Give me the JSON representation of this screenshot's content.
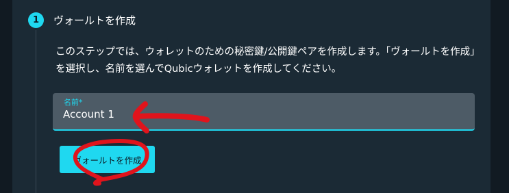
{
  "step": {
    "number": "1",
    "title": "ヴォールトを作成"
  },
  "description": "このステップでは、ウォレットのための秘密鍵/公開鍵ペアを作成します。「ヴォールトを作成」を選択し、名前を選んでQubicウォレットを作成してください。",
  "name_field": {
    "label": "名前*",
    "value": "Account 1"
  },
  "create_button": {
    "label": "ヴォールトを作成"
  },
  "colors": {
    "accent": "#1fd8f0",
    "panel": "#1b2a35",
    "background": "#111a22",
    "annotation": "#e0141c"
  }
}
